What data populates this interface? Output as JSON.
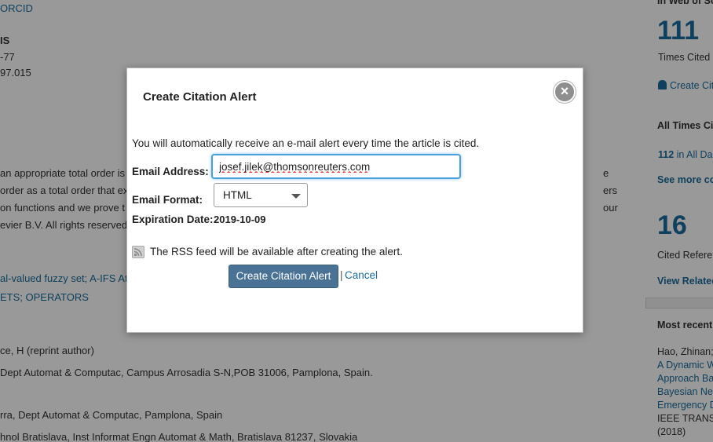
{
  "background": {
    "orcid_link": "ORCID",
    "meta_lines": [
      "IS",
      "-77",
      "97.015"
    ],
    "abstract_lines": [
      "an appropriate total order is",
      "order as a total order that ex",
      "on functions and we prove t",
      "evier B.V. All rights reserved"
    ],
    "abstract_right_fragments": [
      "e",
      "ers",
      "our"
    ],
    "keywords_line1": "al-valued fuzzy set; A-IFS Ata",
    "keywords_line2": "ETS; OPERATORS",
    "author_line": "ce, H (reprint author)",
    "address_line1": "Dept Automat & Computac, Campus Arrosadia S-N,POB 31006, Pamplona, Spain.",
    "address_line2": "rra, Dept Automat & Computac, Pamplona, Spain",
    "address_line3": "hnol Bratislava, Inst Informat Engn Automat & Math, Bratislava 81237, Slovakia"
  },
  "sidebar": {
    "wos_header": "In Web of Scie",
    "times_cited_count": "111",
    "times_cited_label": "Times Cited",
    "create_citation_link": "Create Cita",
    "all_times_cited_header": "All Times Cite",
    "all_databases_count": "112",
    "all_databases_label": " in All Da",
    "see_more_link": "See more cou",
    "cited_refs_count": "16",
    "cited_refs_label": "Cited Referen",
    "view_related_link": "View Related",
    "most_recently_header": "Most recently",
    "recent_author": "Hao, Zhinan;",
    "recent_title_lines": [
      "A Dynamic W",
      "Approach Bas",
      "Bayesian Net",
      "Emergency D"
    ],
    "recent_journal": "IEEE TRANSA",
    "recent_year": "(2018)"
  },
  "modal": {
    "title": "Create Citation Alert",
    "close_symbol": "×",
    "intro_text": "You will automatically receive an e-mail alert every time the article is cited.",
    "email_label": "Email Address:",
    "email_value": "josef.jilek@thomsonreuters.com",
    "format_label": "Email Format:",
    "format_selected": "HTML",
    "expiration_label": "Expiration Date:",
    "expiration_value": "2019-10-09",
    "rss_icon": "rss-icon",
    "rss_text": "The RSS feed will be available after creating the alert.",
    "create_button": "Create Citation Alert",
    "separator": "|",
    "cancel_link": "Cancel"
  },
  "colors": {
    "link": "#1a6c9c",
    "primary_button": "#4a7295",
    "focus_border": "#4aa0d8",
    "overlay": "rgba(0,0,0,0.40)"
  }
}
